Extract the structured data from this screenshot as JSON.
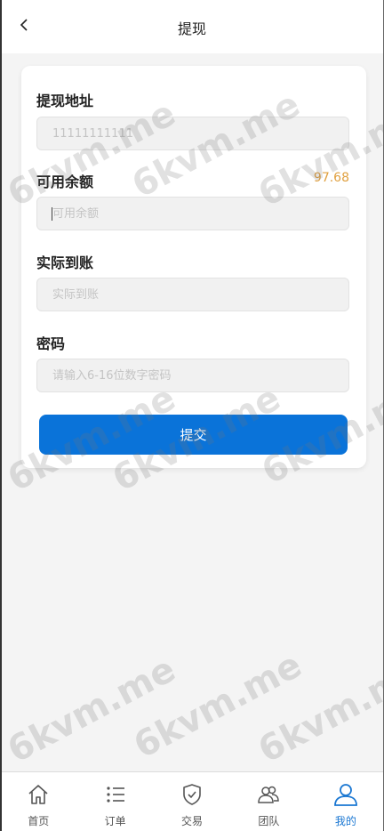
{
  "header": {
    "title": "提现",
    "back_icon": "chevron-left-icon"
  },
  "form": {
    "address_label": "提现地址",
    "address_value": "11111111111",
    "balance_label": "可用余额",
    "balance_value": "97.68",
    "amount_placeholder": "可用余额",
    "received_label": "实际到账",
    "received_placeholder": "实际到账",
    "password_label": "密码",
    "password_placeholder": "请输入6-16位数字密码",
    "submit_label": "提交"
  },
  "tabbar": {
    "items": [
      {
        "label": "首页",
        "icon": "home-icon",
        "active": false
      },
      {
        "label": "订单",
        "icon": "list-icon",
        "active": false
      },
      {
        "label": "交易",
        "icon": "shield-check-icon",
        "active": false
      },
      {
        "label": "团队",
        "icon": "team-icon",
        "active": false
      },
      {
        "label": "我的",
        "icon": "user-icon",
        "active": true
      }
    ]
  },
  "watermark": {
    "text": "6kvm.me"
  },
  "colors": {
    "primary": "#0a73d9",
    "balance": "#e0a040",
    "active_tab": "#1a77d2"
  }
}
